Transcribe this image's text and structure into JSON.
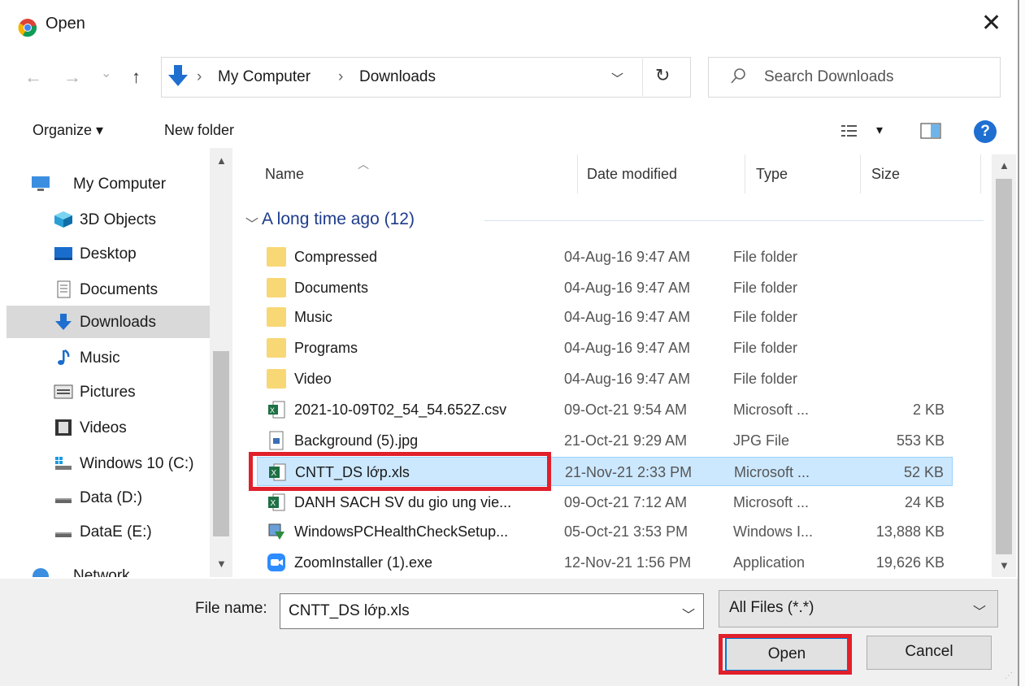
{
  "window": {
    "title": "Open"
  },
  "nav": {
    "back": "←",
    "forward": "→",
    "recent": "⌄",
    "up": "↑",
    "breadcrumb": [
      "My Computer",
      "Downloads"
    ],
    "sep": "›",
    "search_placeholder": "Search Downloads"
  },
  "toolbar": {
    "organize": "Organize ▾",
    "new_folder": "New folder",
    "view_caret": "▾",
    "help": "?"
  },
  "sidebar": {
    "items": [
      {
        "label": "My Computer",
        "icon": "computer-icon"
      },
      {
        "label": "3D Objects",
        "icon": "cube-icon"
      },
      {
        "label": "Desktop",
        "icon": "desktop-icon"
      },
      {
        "label": "Documents",
        "icon": "document-icon"
      },
      {
        "label": "Downloads",
        "icon": "download-icon",
        "selected": true
      },
      {
        "label": "Music",
        "icon": "music-icon"
      },
      {
        "label": "Pictures",
        "icon": "pictures-icon"
      },
      {
        "label": "Videos",
        "icon": "video-icon"
      },
      {
        "label": "Windows 10 (C:)",
        "icon": "drive-c-icon"
      },
      {
        "label": "Data (D:)",
        "icon": "drive-icon"
      },
      {
        "label": "DataE (E:)",
        "icon": "drive-icon"
      },
      {
        "label": "Network",
        "icon": "network-icon"
      }
    ]
  },
  "columns": {
    "name": "Name",
    "date": "Date modified",
    "type": "Type",
    "size": "Size"
  },
  "group": {
    "label": "A long time ago (12)"
  },
  "files": [
    {
      "name": "Compressed",
      "date": "04-Aug-16 9:47 AM",
      "type": "File folder",
      "size": "",
      "icon": "folder-icon"
    },
    {
      "name": "Documents",
      "date": "04-Aug-16 9:47 AM",
      "type": "File folder",
      "size": "",
      "icon": "folder-icon"
    },
    {
      "name": "Music",
      "date": "04-Aug-16 9:47 AM",
      "type": "File folder",
      "size": "",
      "icon": "folder-icon"
    },
    {
      "name": "Programs",
      "date": "04-Aug-16 9:47 AM",
      "type": "File folder",
      "size": "",
      "icon": "folder-icon"
    },
    {
      "name": "Video",
      "date": "04-Aug-16 9:47 AM",
      "type": "File folder",
      "size": "",
      "icon": "folder-icon"
    },
    {
      "name": "2021-10-09T02_54_54.652Z.csv",
      "date": "09-Oct-21 9:54 AM",
      "type": "Microsoft ...",
      "size": "2 KB",
      "icon": "excel-csv-icon"
    },
    {
      "name": "Background (5).jpg",
      "date": "21-Oct-21 9:29 AM",
      "type": "JPG File",
      "size": "553 KB",
      "icon": "image-file-icon"
    },
    {
      "name": "CNTT_DS lớp.xls",
      "date": "21-Nov-21 2:33 PM",
      "type": "Microsoft ...",
      "size": "52 KB",
      "icon": "excel-icon",
      "selected": true
    },
    {
      "name": "DANH SACH SV du gio ung vie...",
      "date": "09-Oct-21 7:12 AM",
      "type": "Microsoft ...",
      "size": "24 KB",
      "icon": "excel-icon"
    },
    {
      "name": "WindowsPCHealthCheckSetup...",
      "date": "05-Oct-21 3:53 PM",
      "type": "Windows I...",
      "size": "13,888 KB",
      "icon": "installer-icon"
    },
    {
      "name": "ZoomInstaller (1).exe",
      "date": "12-Nov-21 1:56 PM",
      "type": "Application",
      "size": "19,626 KB",
      "icon": "zoom-icon"
    }
  ],
  "footer": {
    "file_name_label": "File name:",
    "file_name_value": "CNTT_DS lớp.xls",
    "filter_value": "All Files (*.*)",
    "open_label": "Open",
    "cancel_label": "Cancel"
  },
  "colors": {
    "accent": "#0078d7",
    "selection": "#cce8ff",
    "highlight_box": "#e0202b",
    "group_text": "#1e3c8c"
  }
}
